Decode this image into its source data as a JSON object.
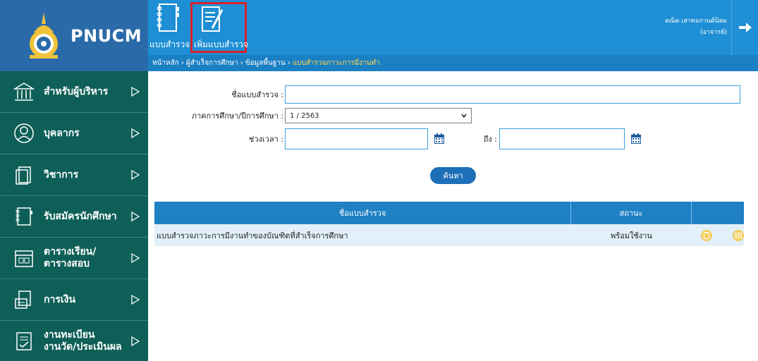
{
  "brand": {
    "name": "PNUCM"
  },
  "topmenu": {
    "items": [
      {
        "label": "แบบสำรวจ",
        "icon": "notebook-icon"
      },
      {
        "label": "เพิ่มแบบสำรวจ",
        "icon": "edit-document-icon"
      }
    ]
  },
  "user": {
    "name": "คณิต เสาทอกานต์นิยม",
    "role": "(อาจารย์)"
  },
  "logout": {
    "icon": "logout-arrow-icon"
  },
  "breadcrumb": {
    "items": [
      "หน้าหลัก",
      "ผู้สำเร็จการศึกษา",
      "ข้อมูลพื้นฐาน"
    ],
    "separator": "›",
    "current": "แบบสำรวจภาวะการมีงานทำ"
  },
  "sidebar": {
    "arrow_icon": "triangle-right-icon",
    "items": [
      {
        "label": "สำหรับผู้บริหาร",
        "icon": "building-icon"
      },
      {
        "label": "บุคลากร",
        "icon": "person-icon"
      },
      {
        "label": "วิชาการ",
        "icon": "books-icon"
      },
      {
        "label": "รับสมัครนักศึกษา",
        "icon": "notebook-icon"
      },
      {
        "label": "ตารางเรียน/",
        "label2": "ตารางสอบ",
        "icon": "calendar-icon"
      },
      {
        "label": "การเงิน",
        "icon": "money-icon"
      },
      {
        "label": "งานทะเบียน",
        "label2": "งานวัด/ประเมินผล",
        "icon": "register-icon"
      }
    ]
  },
  "form": {
    "name_label": "ชื่อแบบสำรวจ :",
    "name_value": "",
    "term_label": "ภาคการศึกษา/ปีการศึกษา :",
    "term_value": "1 / 2563",
    "period_label": "ช่วงเวลา :",
    "period_from": "",
    "to_label": "ถึง :",
    "period_to": "",
    "calendar_icon": "calendar-icon",
    "search_label": "ค้นหา"
  },
  "table": {
    "columns": [
      "ชื่อแบบสำรวจ",
      "สถานะ",
      ""
    ],
    "rows": [
      {
        "name": "แบบสำรวจภาวะการมีงานทำของบัณฑิตที่สำเร็จการศึกษา",
        "status": "พร้อมใช้งาน",
        "actions": [
          "clipboard-icon",
          "list-icon"
        ]
      }
    ]
  },
  "colors": {
    "header_blue": "#1e8fd4",
    "sidebar_green": "#0e5f57",
    "highlight_red": "#d8212d",
    "row_bg": "#e2f0fa"
  }
}
